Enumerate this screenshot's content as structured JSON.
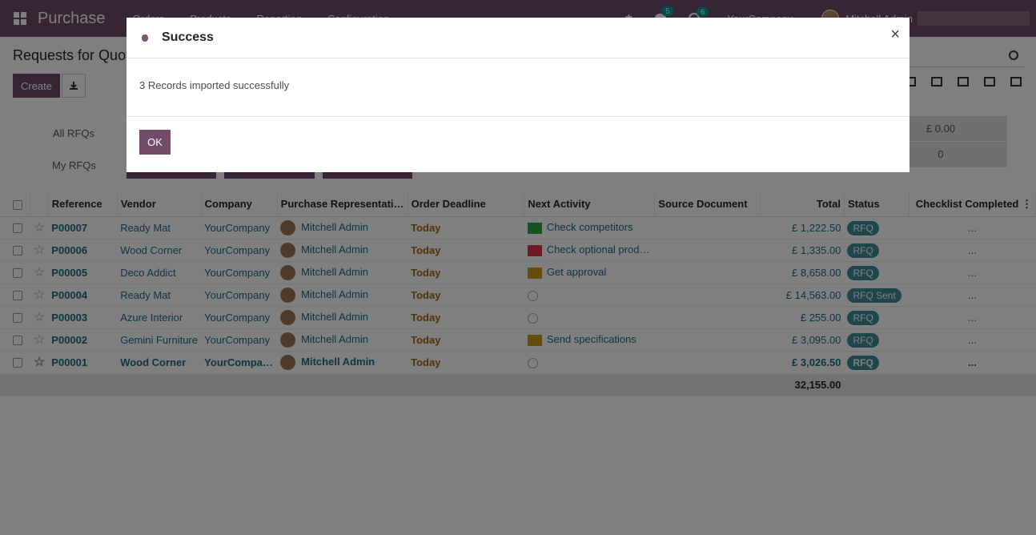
{
  "navbar": {
    "app_title": "Purchase",
    "menu": [
      "Orders",
      "Products",
      "Reporting",
      "Configuration"
    ],
    "messages_count": "5",
    "activities_count": "6",
    "company": "YourCompany",
    "user": "Mitchell Admin"
  },
  "control_panel": {
    "breadcrumb": "Requests for Quotation",
    "create_label": "Create"
  },
  "dashboard": {
    "all_rfqs_label": "All RFQs",
    "my_rfqs_label": "My RFQs",
    "right_value_1": "£ 0.00",
    "right_value_2": "0"
  },
  "table": {
    "columns": [
      "Reference",
      "Vendor",
      "Company",
      "Purchase Representati…",
      "Order Deadline",
      "Next Activity",
      "Source Document",
      "Total",
      "Status",
      "Checklist Completed"
    ],
    "rows": [
      {
        "ref": "P00007",
        "vendor": "Ready Mat",
        "company": "YourCompany",
        "rep": "Mitchell Admin",
        "deadline": "Today",
        "activity": "Check competitors",
        "activity_type": "todo-green",
        "total": "£ 1,222.50",
        "status": "RFQ",
        "checklist": "..."
      },
      {
        "ref": "P00006",
        "vendor": "Wood Corner",
        "company": "YourCompany",
        "rep": "Mitchell Admin",
        "deadline": "Today",
        "activity": "Check optional prod…",
        "activity_type": "todo-red",
        "total": "£ 1,335.00",
        "status": "RFQ",
        "checklist": "..."
      },
      {
        "ref": "P00005",
        "vendor": "Deco Addict",
        "company": "YourCompany",
        "rep": "Mitchell Admin",
        "deadline": "Today",
        "activity": "Get approval",
        "activity_type": "todo-yellow",
        "total": "£ 8,658.00",
        "status": "RFQ",
        "checklist": "..."
      },
      {
        "ref": "P00004",
        "vendor": "Ready Mat",
        "company": "YourCompany",
        "rep": "Mitchell Admin",
        "deadline": "Today",
        "activity": "",
        "activity_type": "clock",
        "total": "£ 14,563.00",
        "status": "RFQ Sent",
        "checklist": "..."
      },
      {
        "ref": "P00003",
        "vendor": "Azure Interior",
        "company": "YourCompany",
        "rep": "Mitchell Admin",
        "deadline": "Today",
        "activity": "",
        "activity_type": "clock",
        "total": "£ 255.00",
        "status": "RFQ",
        "checklist": "..."
      },
      {
        "ref": "P00002",
        "vendor": "Gemini Furniture",
        "company": "YourCompany",
        "rep": "Mitchell Admin",
        "deadline": "Today",
        "activity": "Send specifications",
        "activity_type": "email",
        "total": "£ 3,095.00",
        "status": "RFQ",
        "checklist": "..."
      },
      {
        "ref": "P00001",
        "vendor": "Wood Corner",
        "company": "YourCompa…",
        "rep": "Mitchell Admin",
        "deadline": "Today",
        "activity": "",
        "activity_type": "clock",
        "total": "£ 3,026.50",
        "status": "RFQ",
        "checklist": "..."
      }
    ],
    "sum_total": "32,155.00"
  },
  "modal": {
    "title": "Success",
    "message": "3 Records imported successfully",
    "ok_label": "OK",
    "close_glyph": "×"
  },
  "colors": {
    "brand": "#714b67",
    "link": "#1f6c7c",
    "deadline": "#a06a14",
    "status_badge": "#3d8c96"
  }
}
